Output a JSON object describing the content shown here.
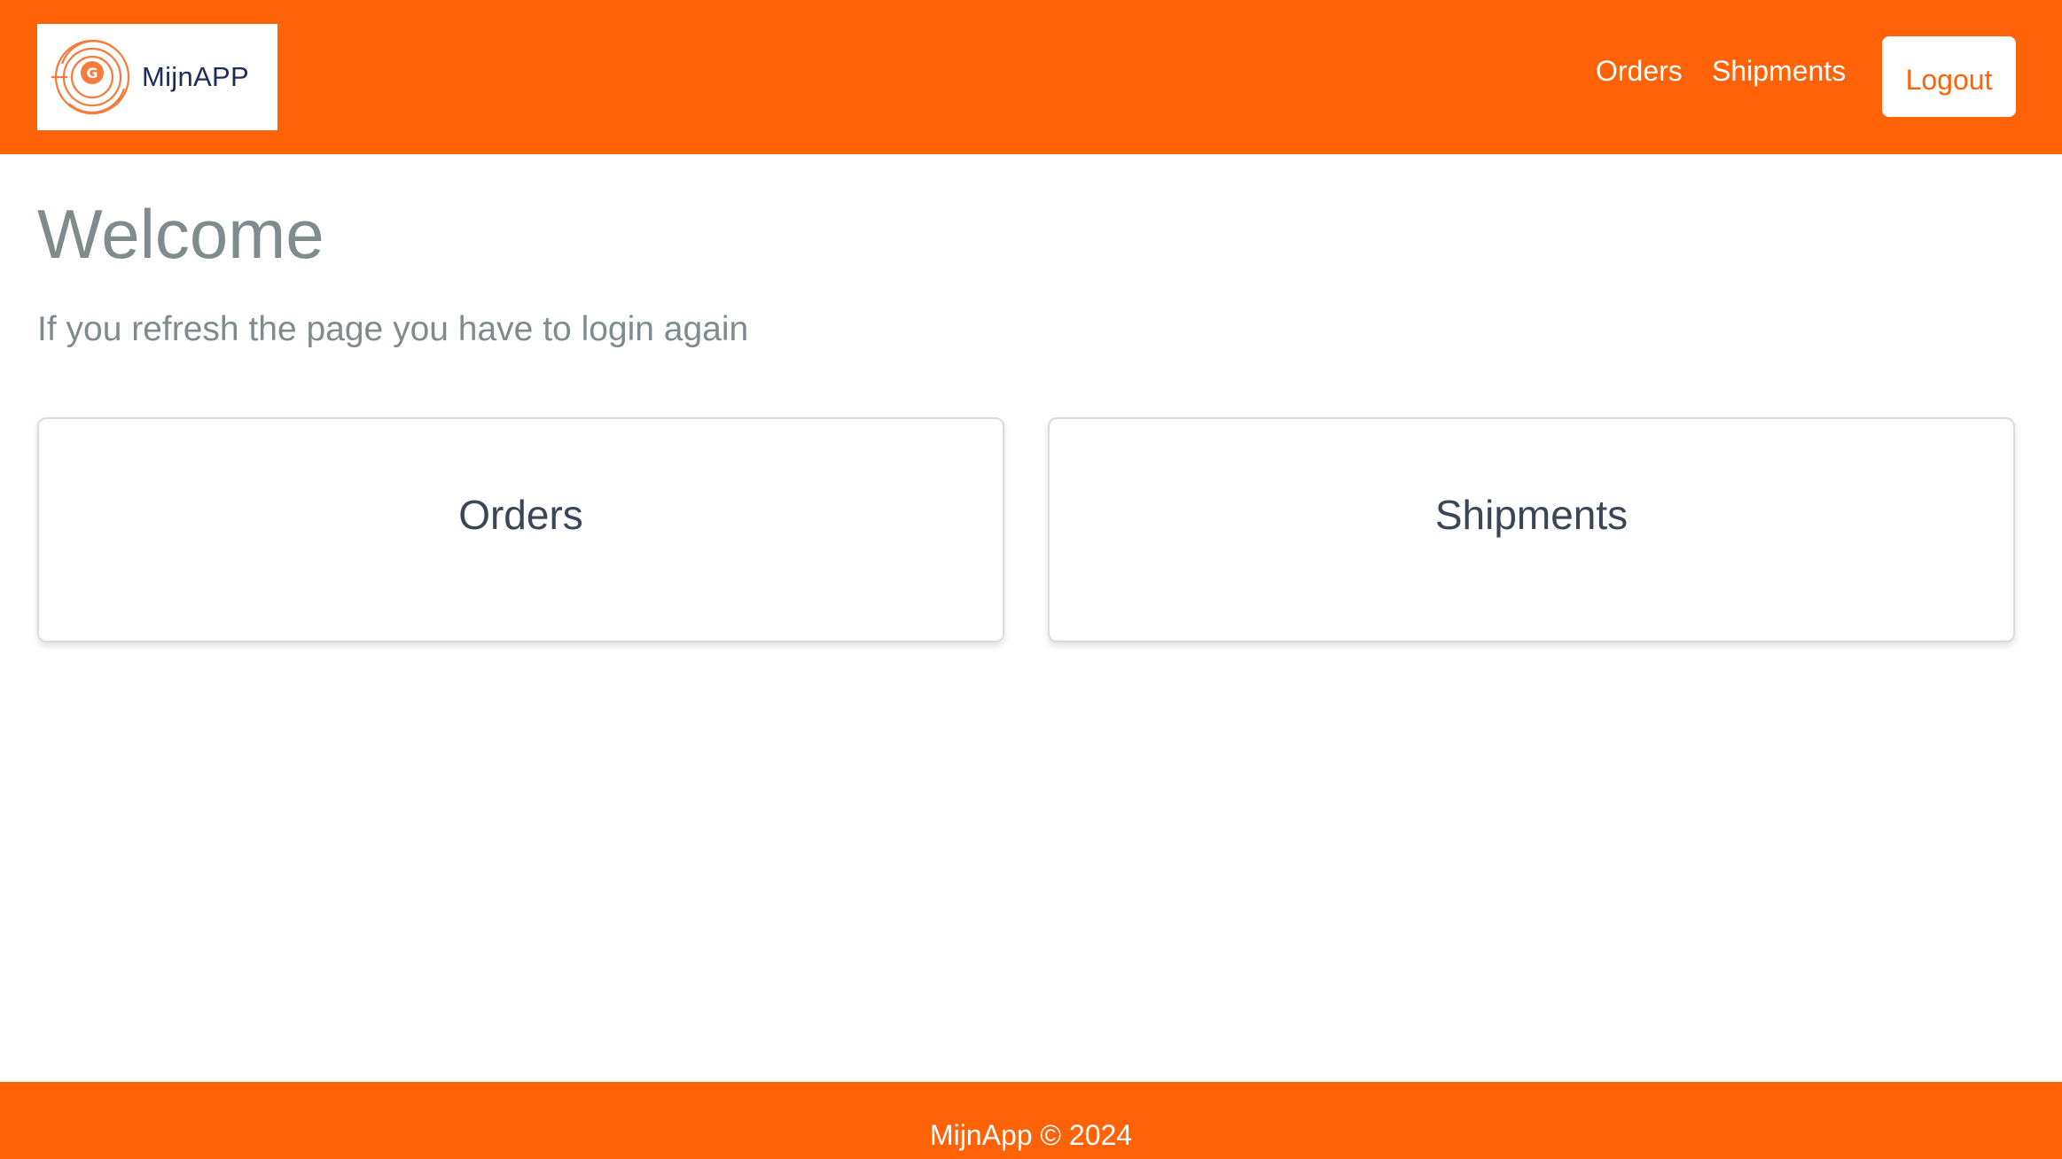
{
  "header": {
    "logo_text": "MijnAPP",
    "nav": {
      "orders_label": "Orders",
      "shipments_label": "Shipments"
    },
    "logout_label": "Logout"
  },
  "main": {
    "title": "Welcome",
    "subtitle": "If you refresh the page you have to login again",
    "cards": [
      {
        "title": "Orders"
      },
      {
        "title": "Shipments"
      }
    ]
  },
  "footer": {
    "text": "MijnApp © 2024"
  },
  "colors": {
    "brand": "#ff6207",
    "heading": "#7f8b8c",
    "card_text": "#3a4655",
    "logo_text": "#1d2c5a"
  },
  "icons": {
    "logo": "concentric-target-logo-icon"
  }
}
